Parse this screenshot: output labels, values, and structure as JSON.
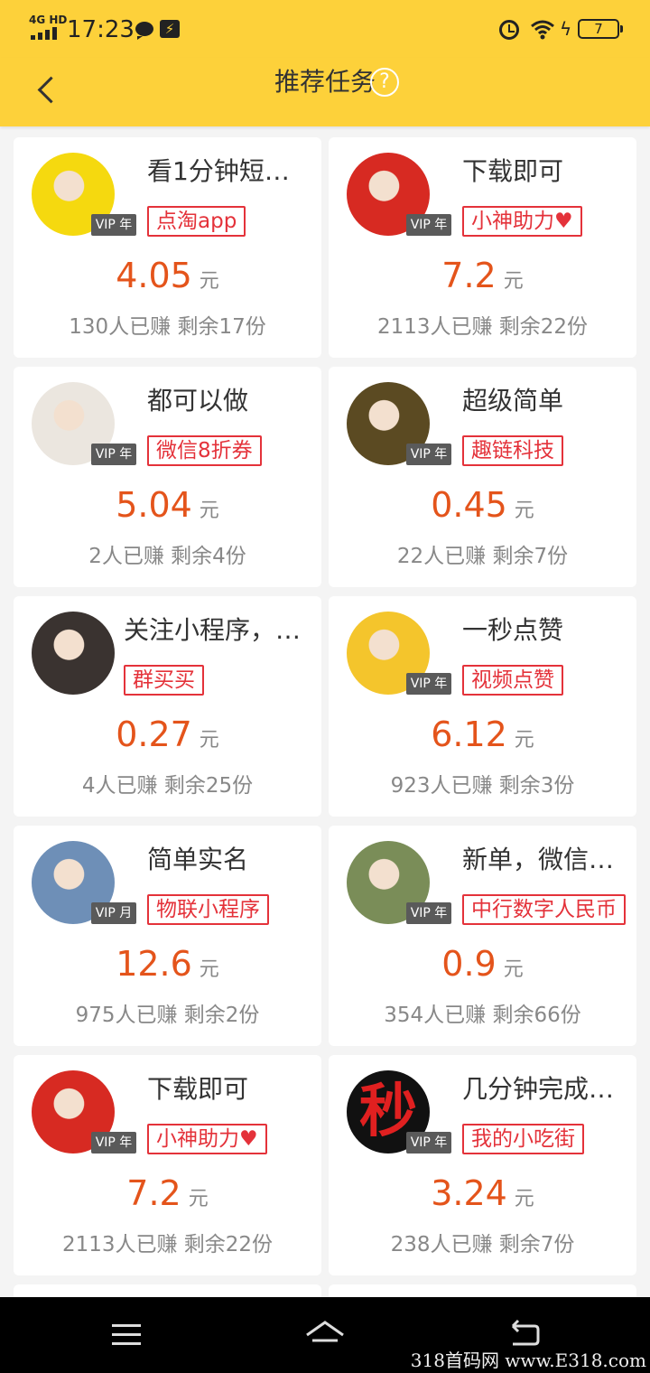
{
  "status_bar": {
    "network": "4G HD",
    "time": "17:23",
    "battery": "7"
  },
  "header": {
    "title": "推荐任务",
    "help": "?"
  },
  "tasks": [
    {
      "title": "看1分钟短…",
      "tag": "点淘app",
      "tag_heart": "",
      "vip": "VIP 年",
      "price": "4.05",
      "unit": "元",
      "stats": "130人已赚 剩余17份",
      "avatar_color": "#f5d90f"
    },
    {
      "title": "下载即可",
      "tag": "小神助力",
      "tag_heart": "♥",
      "vip": "VIP 年",
      "price": "7.2",
      "unit": "元",
      "stats": "2113人已赚 剩余22份",
      "avatar_color": "#d72a22"
    },
    {
      "title": "都可以做",
      "tag": "微信8折券",
      "tag_heart": "",
      "vip": "VIP 年",
      "price": "5.04",
      "unit": "元",
      "stats": "2人已赚 剩余4份",
      "avatar_color": "#ebe6df"
    },
    {
      "title": "超级简单",
      "tag": "趣链科技",
      "tag_heart": "",
      "vip": "VIP 年",
      "price": "0.45",
      "unit": "元",
      "stats": "22人已赚 剩余7份",
      "avatar_color": "#5b4a22"
    },
    {
      "title": "关注小程序，…",
      "tag": "群买买",
      "tag_heart": "",
      "vip": "",
      "price": "0.27",
      "unit": "元",
      "stats": "4人已赚 剩余25份",
      "avatar_color": "#3a3330"
    },
    {
      "title": "一秒点赞",
      "tag": "视频点赞",
      "tag_heart": "",
      "vip": "VIP 年",
      "price": "6.12",
      "unit": "元",
      "stats": "923人已赚 剩余3份",
      "avatar_color": "#f4c52c"
    },
    {
      "title": "简单实名",
      "tag": "物联小程序",
      "tag_heart": "",
      "vip": "VIP 月",
      "price": "12.6",
      "unit": "元",
      "stats": "975人已赚 剩余2份",
      "avatar_color": "#6e8fb7"
    },
    {
      "title": "新单，微信…",
      "tag": "中行数字人民币",
      "tag_heart": "",
      "vip": "VIP 年",
      "price": "0.9",
      "unit": "元",
      "stats": "354人已赚 剩余66份",
      "avatar_color": "#7a8d58"
    },
    {
      "title": "下载即可",
      "tag": "小神助力",
      "tag_heart": "♥",
      "vip": "VIP 年",
      "price": "7.2",
      "unit": "元",
      "stats": "2113人已赚 剩余22份",
      "avatar_color": "#d72a22"
    },
    {
      "title": "几分钟完成…",
      "tag": "我的小吃街",
      "tag_heart": "",
      "vip": "VIP 年",
      "price": "3.24",
      "unit": "元",
      "stats": "238人已赚 剩余7份",
      "avatar_color": "#111111",
      "avatar_text": "秒"
    }
  ],
  "watermark": "318首码网 www.E318.com"
}
